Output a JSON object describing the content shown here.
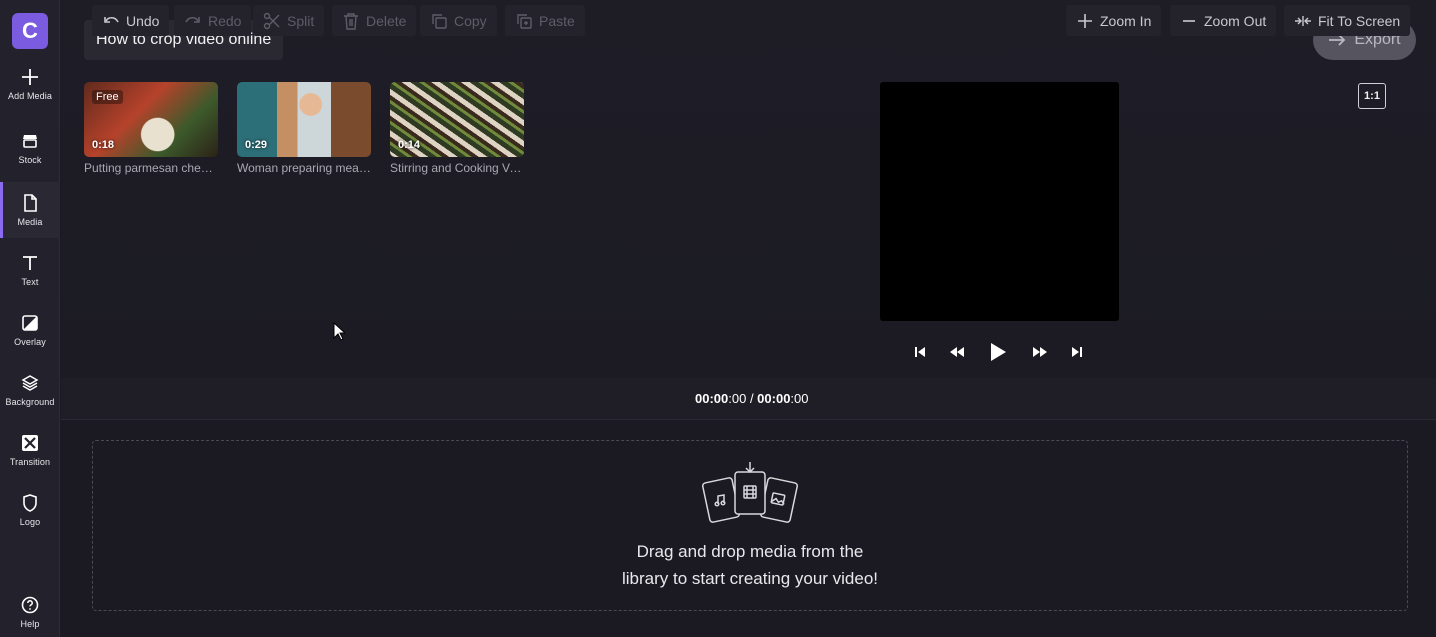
{
  "sidebar": {
    "logo_letter": "C",
    "items": [
      {
        "label": "Add Media",
        "icon": "plus-icon"
      },
      {
        "label": "Stock",
        "icon": "store-icon"
      },
      {
        "label": "Media",
        "icon": "file-icon"
      },
      {
        "label": "Text",
        "icon": "text-icon"
      },
      {
        "label": "Overlay",
        "icon": "overlay-icon"
      },
      {
        "label": "Background",
        "icon": "layers-icon"
      },
      {
        "label": "Transition",
        "icon": "transition-icon"
      },
      {
        "label": "Logo",
        "icon": "shield-icon"
      },
      {
        "label": "Help",
        "icon": "help-icon"
      }
    ],
    "active": "Media"
  },
  "header": {
    "project_title": "How to crop video online",
    "export_label": "Export"
  },
  "media": [
    {
      "title": "Putting parmesan chees…",
      "duration": "0:18",
      "badge": "Free"
    },
    {
      "title": "Woman preparing meal …",
      "duration": "0:29"
    },
    {
      "title": "Stirring and Cooking Ve…",
      "duration": "0:14"
    }
  ],
  "preview": {
    "aspect_ratio": "1:1"
  },
  "toolbar": {
    "undo": "Undo",
    "redo": "Redo",
    "split": "Split",
    "delete": "Delete",
    "copy": "Copy",
    "paste": "Paste",
    "zoom_in": "Zoom In",
    "zoom_out": "Zoom Out",
    "fit_to_screen": "Fit To Screen"
  },
  "timecode": {
    "current_main": "00:00",
    "current_frac": ":00",
    "separator": " / ",
    "total_main": "00:00",
    "total_frac": ":00"
  },
  "timeline": {
    "drop_line1": "Drag and drop media from the",
    "drop_line2": "library to start creating your video!"
  },
  "colors": {
    "accent": "#7b5ce0",
    "background": "#1b1a23",
    "export_button": "#56555f"
  }
}
